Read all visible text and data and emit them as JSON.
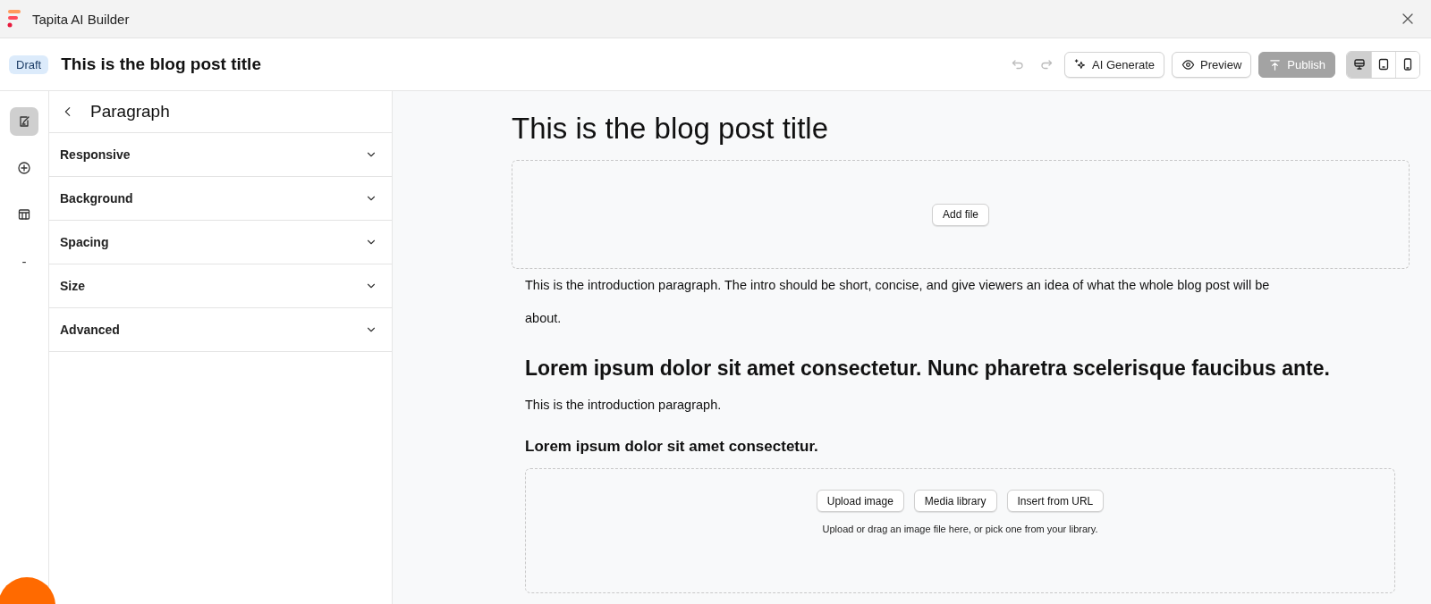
{
  "titlebar": {
    "app_name": "Tapita AI Builder"
  },
  "header": {
    "status_badge": "Draft",
    "title": "This is the blog post title",
    "buttons": [
      {
        "kind": "ai",
        "label": "AI Generate",
        "disabled": false
      },
      {
        "kind": "preview",
        "label": "Preview",
        "disabled": false
      },
      {
        "kind": "publish",
        "label": "Publish",
        "disabled": true
      }
    ],
    "devices": [
      {
        "kind": "desktop",
        "selected": true
      },
      {
        "kind": "tablet",
        "selected": false
      },
      {
        "kind": "mobile",
        "selected": false
      }
    ]
  },
  "rail": [
    {
      "kind": "edit",
      "selected": true
    },
    {
      "kind": "add",
      "selected": false
    },
    {
      "kind": "table",
      "selected": false
    },
    {
      "kind": "text",
      "label": "-",
      "selected": false
    }
  ],
  "panel": {
    "title": "Paragraph",
    "sections": [
      {
        "label": "Responsive",
        "expanded": false
      },
      {
        "label": "Background",
        "expanded": false
      },
      {
        "label": "Spacing",
        "expanded": false
      },
      {
        "label": "Size",
        "expanded": false
      },
      {
        "label": "Advanced",
        "expanded": false
      }
    ]
  },
  "canvas": {
    "title": "This is the blog post title",
    "blocks": [
      {
        "kind": "file_upload",
        "button": "Add file"
      },
      {
        "kind": "paragraph",
        "text": "This is the introduction paragraph. The intro should be short, concise, and give viewers an idea of what the whole blog post will be about."
      },
      {
        "kind": "h2",
        "text": "Lorem ipsum dolor sit amet consectetur. Nunc pharetra scelerisque faucibus ante."
      },
      {
        "kind": "paragraph",
        "text": "This is the introduction paragraph."
      },
      {
        "kind": "h3",
        "text": "Lorem ipsum dolor sit amet consectetur."
      },
      {
        "kind": "image_upload",
        "buttons": [
          "Upload image",
          "Media library",
          "Insert from URL"
        ],
        "hint": "Upload or drag an image file here, or pick one from your library."
      }
    ]
  }
}
